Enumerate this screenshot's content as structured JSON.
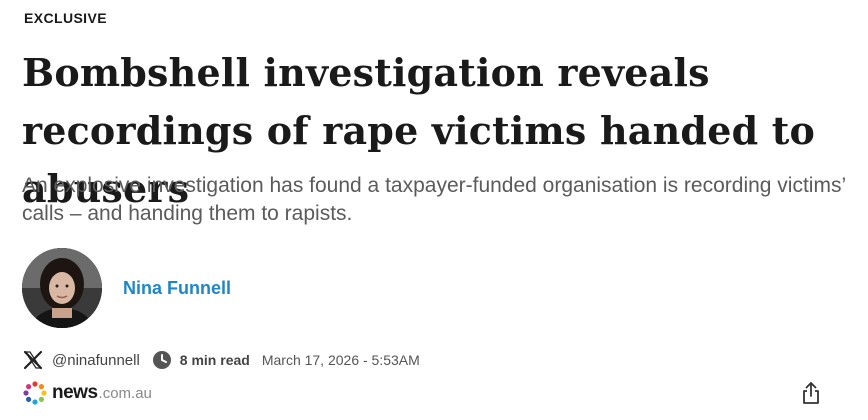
{
  "article": {
    "tag": "EXCLUSIVE",
    "headline": "Bombshell investigation reveals recordings of rape victims handed to abusers",
    "standfirst": "An explosive investigation has found a taxpayer-funded organisation is recording victims’ calls – and handing them to rapists."
  },
  "author": {
    "name": "Nina Funnell",
    "handle": "@ninafunnell",
    "avatar_icon": "author-photo"
  },
  "meta": {
    "read_time": "8 min read",
    "date": "March 17, 2026 - 5:53AM",
    "social_icon": "x-icon",
    "clock_icon": "clock-icon"
  },
  "brand": {
    "name": "news",
    "domain": ".com.au",
    "logo_icon": "newscomau-dots-logo"
  },
  "actions": {
    "share_icon": "share-icon"
  },
  "colors": {
    "author_link": "#1f87c6",
    "headline": "#1a1a1a",
    "standfirst": "#5b5b5b"
  }
}
